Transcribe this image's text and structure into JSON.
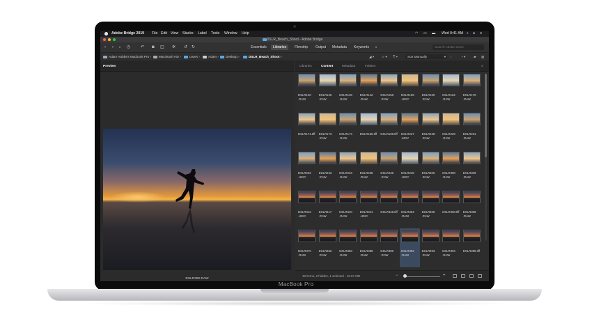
{
  "device": {
    "brand": "MacBook Pro"
  },
  "menubar": {
    "app": "Adobe Bridge 2019",
    "items": [
      "File",
      "Edit",
      "View",
      "Stacks",
      "Label",
      "Tools",
      "Window",
      "Help"
    ],
    "clock": "Wed 9:41 AM"
  },
  "window": {
    "title": "DSLR_Beach_Shoot - Adobe Bridge"
  },
  "toolbar": {
    "workspaces": [
      "Essentials",
      "Libraries",
      "Filmstrip",
      "Output",
      "Metadata",
      "Keywords"
    ],
    "active_workspace": "Libraries",
    "search_placeholder": "Search Adobe Stock"
  },
  "path": {
    "crumbs": [
      "Adam Hobbs's Macbook Pro",
      "Macintosh HD",
      "Users",
      "Adam",
      "Desktop",
      "DSLR_Beach_Shoot"
    ],
    "sort": "Sort Manually"
  },
  "preview": {
    "tab": "Preview",
    "caption": "DSLR392.RAW"
  },
  "panels": {
    "tabs": [
      "Libraries",
      "Content",
      "Metadata",
      "Folders"
    ],
    "active": "Content"
  },
  "content": {
    "items": [
      "DSLR120\n.RAW",
      "DSLR136\n.RAW",
      "DSLR139\n.RAW",
      "DSLR142\n.RAW",
      "DSLR158\n.RAW",
      "DSLR159\n.HEIC",
      "DSLR160\n.RAW",
      "DSLR162\n.RAW",
      "DSLR170\n.RAW",
      "DSLR171.tiff",
      "DSLR173\n.RAW",
      "DSLR174\n.RAW",
      "DSLR186.tiff",
      "DSLR198.tiff",
      "DSLR227\n.MOV",
      "DSLR228\n.RAW",
      "DSLR229\n.RAW",
      "DSLR231\n.RAW",
      "DSLR232\n.HEIC",
      "DSLR233\n.RAW",
      "DSLR234\n.RAW",
      "DSLR235\n.RAW",
      "DSLR236\n.RAW",
      "DSLR239\n.HEIC",
      "DSLR306\n.RAW",
      "DSLR308\n.RAW",
      "DSLR309\n.RAW",
      "DSLR312\n.HEIC",
      "DSLR317\n.RAW",
      "DSLR340\n.RAW",
      "DSLR341\n.HEIC",
      "DSLR345.tiff",
      "DSLR364\n.RAW",
      "DSLR366\n.RAW",
      "DSLR368.tiff",
      "DSLR369\n.RAW",
      "DSLR370\n.RAW",
      "DSLR382\n.RAW",
      "DSLR383\n.RAW",
      "DSLR385\n.RAW",
      "DSLR386\n.RAW",
      "DSLR392\n.RAW",
      "DSLR393\n.RAW",
      "DSLR394\n.RAW",
      "DSLR395.tiff"
    ],
    "selected_index": 41,
    "status": "48 items, 2 hidden, 1 selected - 19.67 MB"
  },
  "colors": {
    "accent": "#5aa9e6",
    "selection": "#3b4a5e",
    "background": "#2b2b2b"
  }
}
